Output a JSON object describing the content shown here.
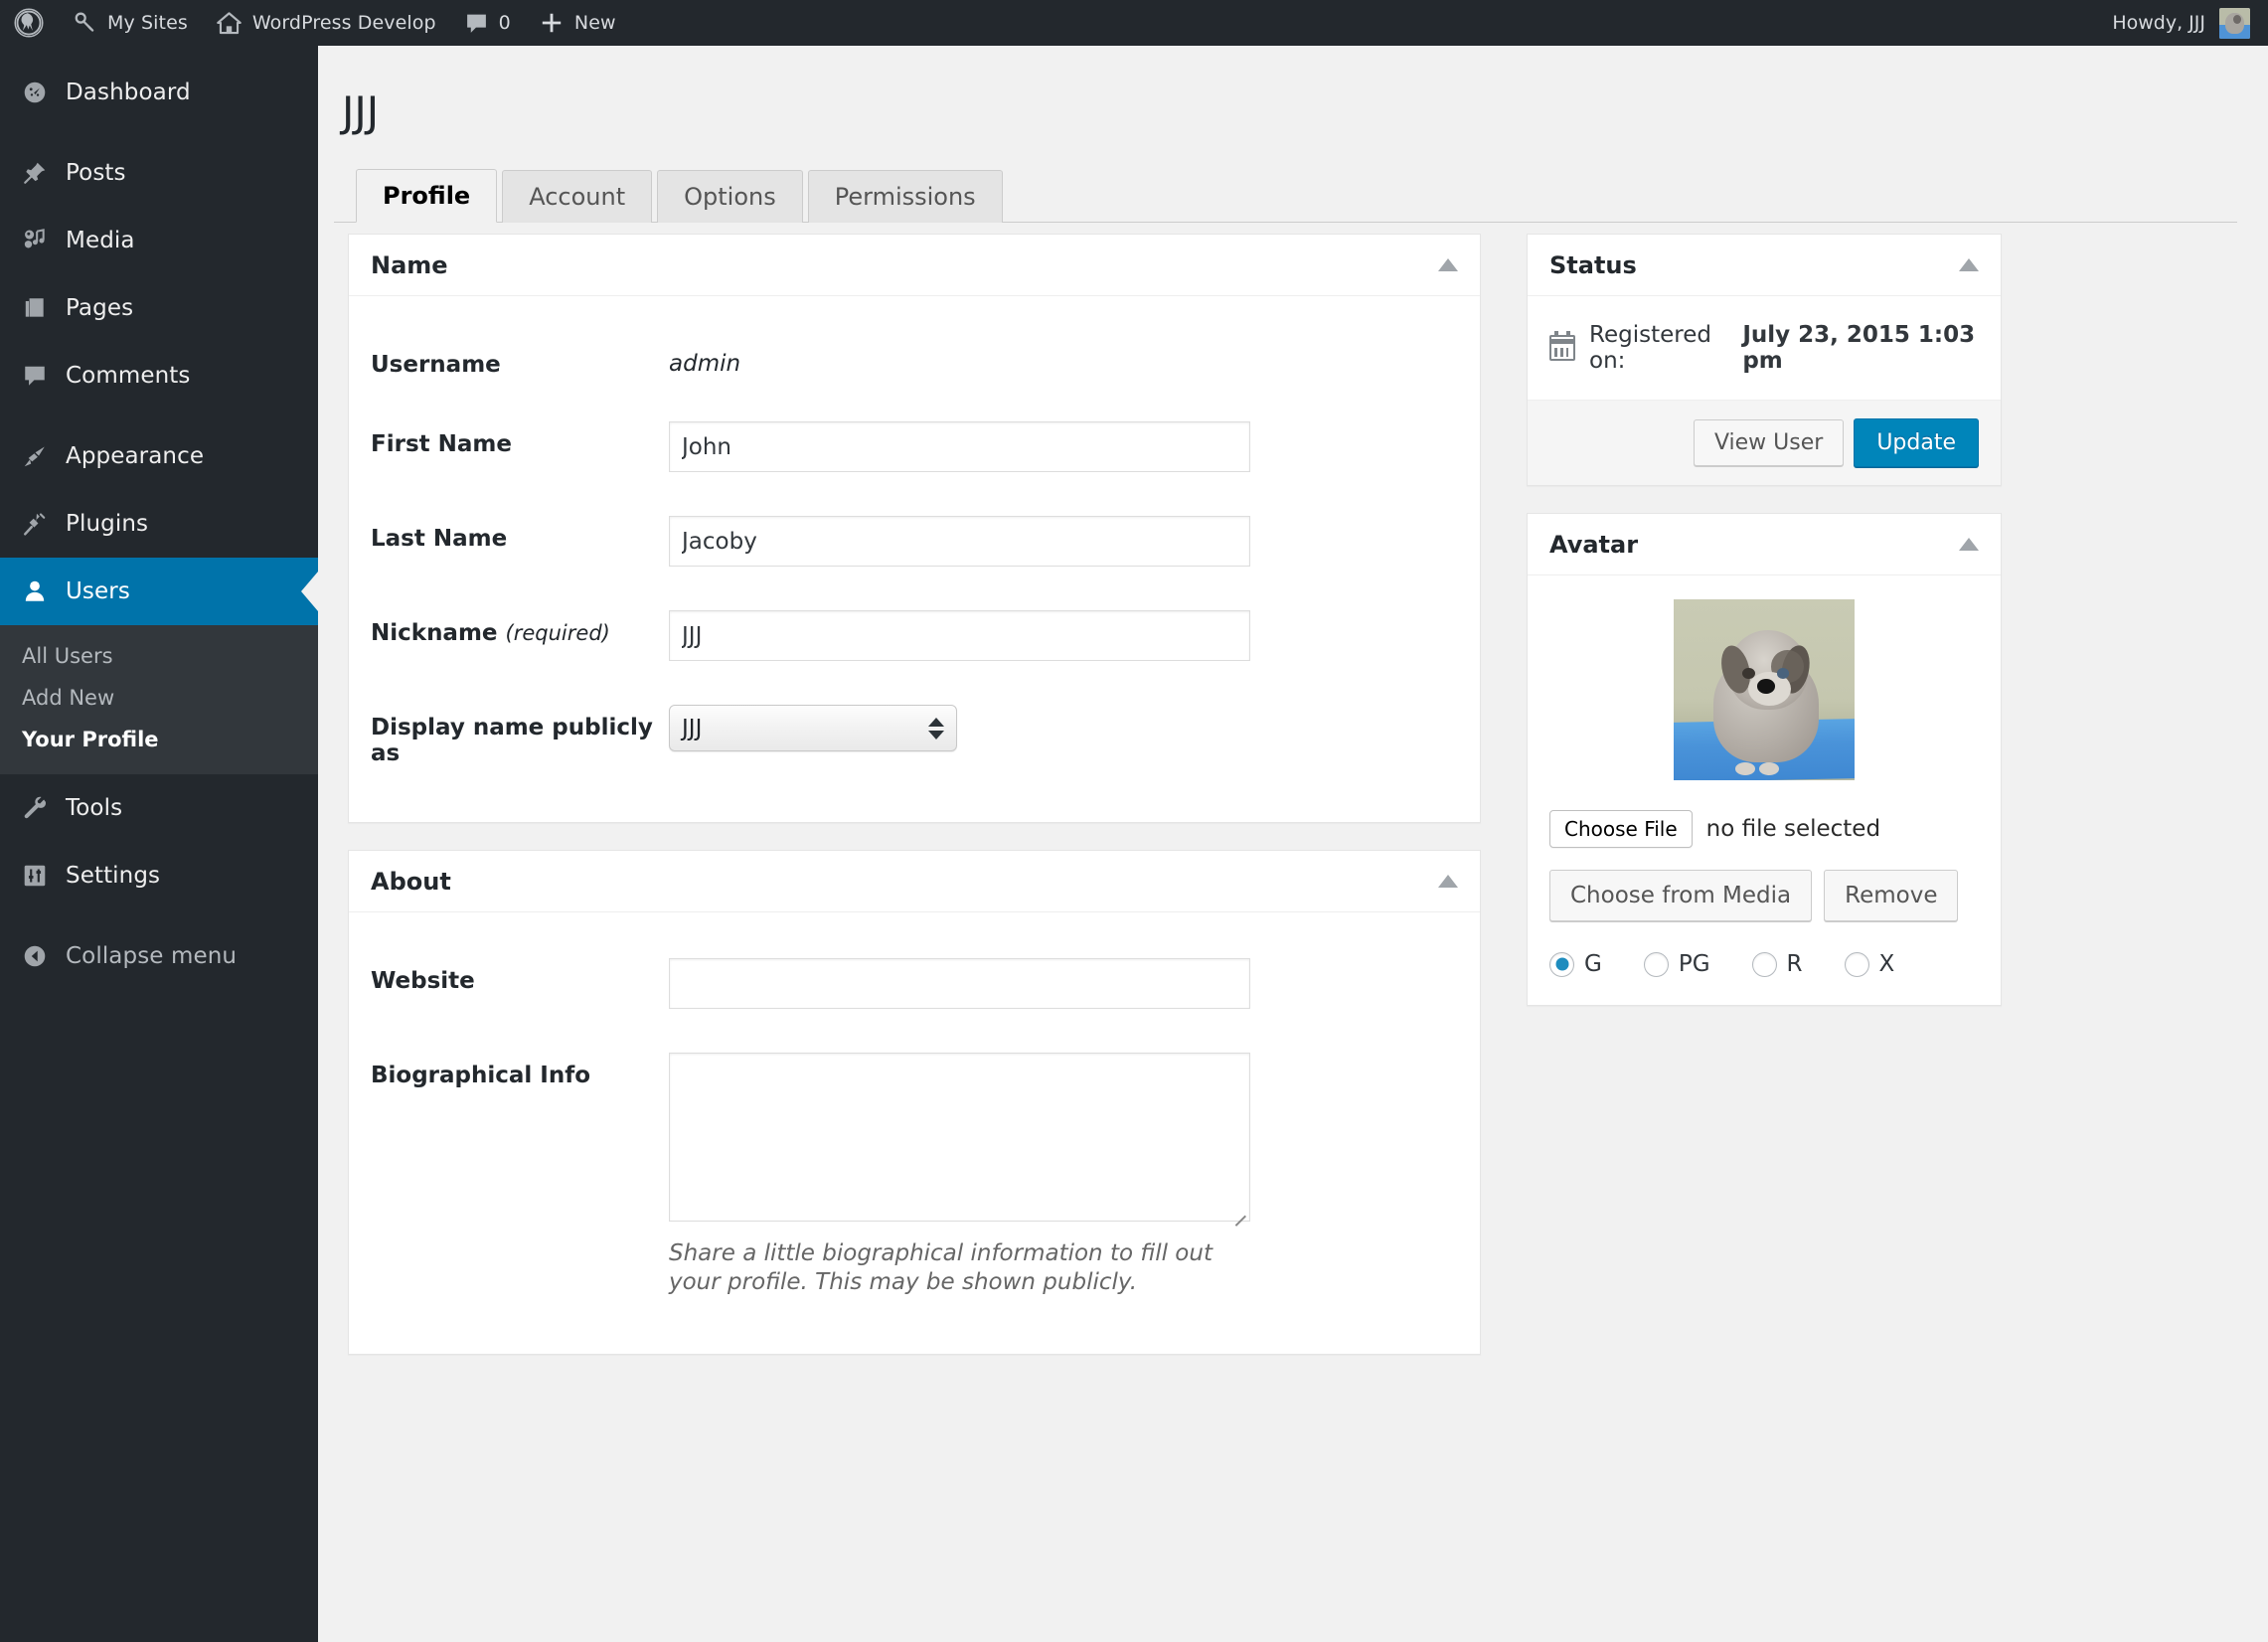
{
  "adminbar": {
    "wp_logo": "wordpress-logo-icon",
    "items": [
      {
        "icon": "key-icon",
        "label": "My Sites"
      },
      {
        "icon": "home-icon",
        "label": "WordPress Develop"
      },
      {
        "icon": "comment-icon",
        "label": "0"
      },
      {
        "icon": "plus-icon",
        "label": "New"
      }
    ],
    "howdy": "Howdy, JJJ"
  },
  "sidebar": {
    "items": [
      {
        "label": "Dashboard",
        "icon": "dashboard-icon",
        "current": false
      },
      {
        "label": "Posts",
        "icon": "pin-icon",
        "current": false
      },
      {
        "label": "Media",
        "icon": "media-icon",
        "current": false
      },
      {
        "label": "Pages",
        "icon": "pages-icon",
        "current": false
      },
      {
        "label": "Comments",
        "icon": "comment-icon",
        "current": false
      },
      {
        "label": "Appearance",
        "icon": "brush-icon",
        "current": false
      },
      {
        "label": "Plugins",
        "icon": "plug-icon",
        "current": false
      },
      {
        "label": "Users",
        "icon": "user-icon",
        "current": true
      },
      {
        "label": "Tools",
        "icon": "wrench-icon",
        "current": false
      },
      {
        "label": "Settings",
        "icon": "settings-icon",
        "current": false
      }
    ],
    "submenu": [
      {
        "label": "All Users",
        "current": false
      },
      {
        "label": "Add New",
        "current": false
      },
      {
        "label": "Your Profile",
        "current": true
      }
    ],
    "collapse": {
      "label": "Collapse menu",
      "icon": "collapse-icon"
    }
  },
  "page": {
    "title": "JJJ",
    "tabs": [
      {
        "label": "Profile",
        "active": true
      },
      {
        "label": "Account",
        "active": false
      },
      {
        "label": "Options",
        "active": false
      },
      {
        "label": "Permissions",
        "active": false
      }
    ]
  },
  "name_box": {
    "title": "Name",
    "fields": {
      "username_label": "Username",
      "username_value": "admin",
      "first_name_label": "First Name",
      "first_name_value": "John",
      "last_name_label": "Last Name",
      "last_name_value": "Jacoby",
      "nickname_label": "Nickname",
      "nickname_required": "(required)",
      "nickname_value": "JJJ",
      "display_name_label": "Display name publicly as",
      "display_name_value": "JJJ",
      "display_name_options": [
        "JJJ"
      ]
    }
  },
  "about_box": {
    "title": "About",
    "fields": {
      "website_label": "Website",
      "website_value": "",
      "bio_label": "Biographical Info",
      "bio_value": "",
      "bio_description": "Share a little biographical information to fill out your profile. This may be shown publicly."
    }
  },
  "status_box": {
    "title": "Status",
    "registered_prefix": "Registered on:",
    "registered_date": "July 23, 2015 1:03 pm",
    "view_user_label": "View User",
    "update_label": "Update"
  },
  "avatar_box": {
    "title": "Avatar",
    "choose_file_label": "Choose File",
    "no_file_text": "no file selected",
    "choose_media_label": "Choose from Media",
    "remove_label": "Remove",
    "ratings": [
      {
        "label": "G",
        "checked": true
      },
      {
        "label": "PG",
        "checked": false
      },
      {
        "label": "R",
        "checked": false
      },
      {
        "label": "X",
        "checked": false
      }
    ]
  },
  "colors": {
    "accent": "#0073aa",
    "primary_button": "#0085ba",
    "admin_bar": "#23282d",
    "sidebar": "#23282d",
    "submenu": "#32373c",
    "page_bg": "#f1f1f1"
  }
}
